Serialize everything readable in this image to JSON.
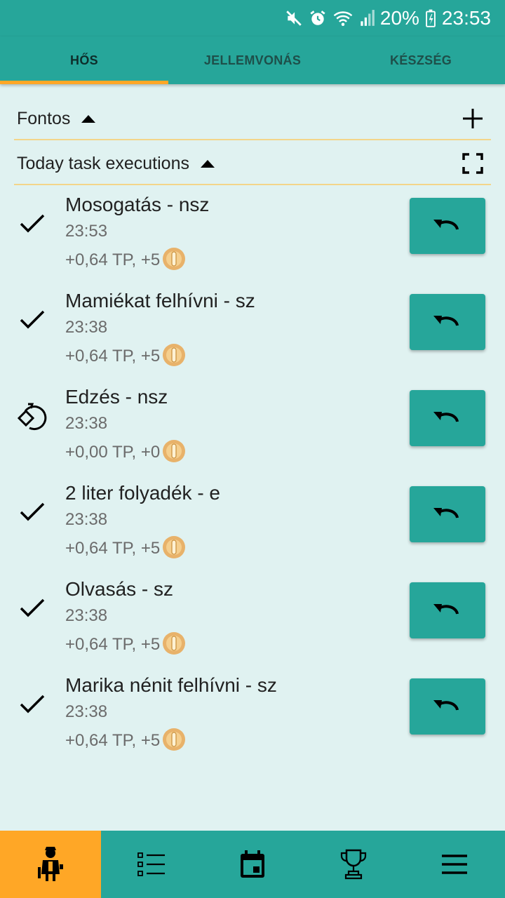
{
  "status_bar": {
    "battery": "20%",
    "time": "23:53",
    "icons": [
      "mute-icon",
      "alarm-icon",
      "wifi-icon",
      "signal-icon",
      "battery-icon"
    ]
  },
  "tabs": [
    {
      "label": "HŐS",
      "active": true
    },
    {
      "label": "JELLEMVONÁS",
      "active": false
    },
    {
      "label": "KÉSZSÉG",
      "active": false
    }
  ],
  "sections": {
    "fontos": {
      "title": "Fontos",
      "action_icon": "plus-icon"
    },
    "today": {
      "title": "Today task executions",
      "action_icon": "fullscreen-icon"
    }
  },
  "tasks": [
    {
      "name": "Mosogatás - nsz",
      "time": "23:53",
      "reward": "+0,64 TP, +5",
      "status_icon": "check-icon"
    },
    {
      "name": "Mamiékat felhívni - sz",
      "time": "23:38",
      "reward": "+0,64 TP, +5",
      "status_icon": "check-icon"
    },
    {
      "name": "Edzés - nsz",
      "time": "23:38",
      "reward": "+0,00 TP, +0",
      "status_icon": "rotate-icon"
    },
    {
      "name": "2 liter folyadék - e",
      "time": "23:38",
      "reward": "+0,64 TP, +5",
      "status_icon": "check-icon"
    },
    {
      "name": "Olvasás - sz",
      "time": "23:38",
      "reward": "+0,64 TP, +5",
      "status_icon": "check-icon"
    },
    {
      "name": "Marika nénit felhívni - sz",
      "time": "23:38",
      "reward": "+0,64 TP, +5",
      "status_icon": "check-icon"
    }
  ],
  "bottom_nav": [
    {
      "icon": "hero-icon",
      "active": true
    },
    {
      "icon": "task-list-icon",
      "active": false
    },
    {
      "icon": "calendar-icon",
      "active": false
    },
    {
      "icon": "trophy-icon",
      "active": false
    },
    {
      "icon": "menu-icon",
      "active": false
    }
  ],
  "colors": {
    "primary": "#26a69a",
    "accent": "#ffa726",
    "background": "#e0f2f1",
    "divider": "#f3d58a"
  }
}
